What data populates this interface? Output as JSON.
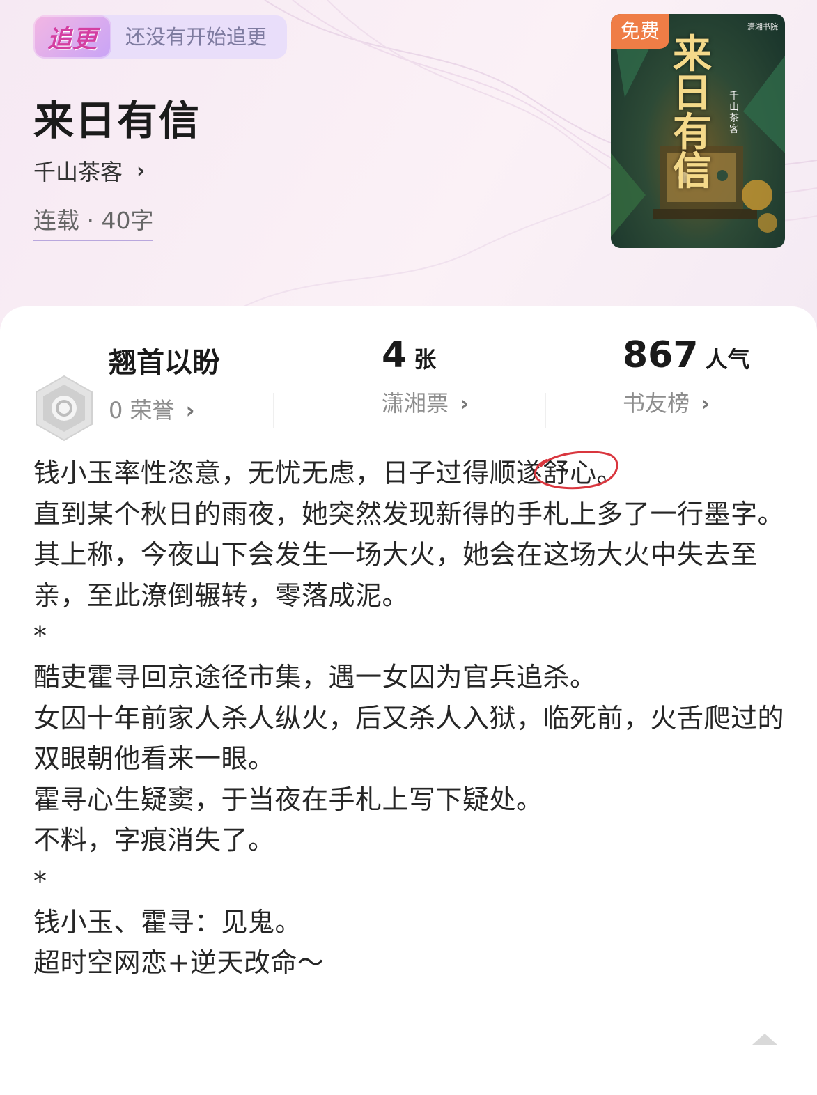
{
  "header": {
    "follow_button": "追更",
    "follow_status": "还没有开始追更",
    "title": "来日有信",
    "author": "千山茶客",
    "author_chevron": "›",
    "status": "连载 · 40字"
  },
  "cover": {
    "badge": "免费",
    "publisher": "潇湘书院",
    "title": "来日有信",
    "author": "千山茶客"
  },
  "stats": {
    "honor": {
      "title": "翘首以盼",
      "sub": "0 荣誉",
      "arrow": "›",
      "icon": "medal-icon"
    },
    "tickets": {
      "value": "4",
      "unit": "张",
      "sub": "潇湘票",
      "arrow": "›"
    },
    "popularity": {
      "value": "867",
      "unit": "人气",
      "sub": "书友榜",
      "arrow": "›"
    }
  },
  "description": {
    "line1_before": "钱小玉率性恣意，无忧无虑，日子过得顺遂",
    "line1_highlight": "舒心",
    "line1_after": "。",
    "p2": "直到某个秋日的雨夜，她突然发现新得的手札上多了一行墨字。",
    "p3": "其上称，今夜山下会发生一场大火，她会在这场大火中失去至亲，至此潦倒辗转，零落成泥。",
    "sep1": "*",
    "p4": "酷吏霍寻回京途径市集，遇一女囚为官兵追杀。",
    "p5": "女囚十年前家人杀人纵火，后又杀人入狱，临死前，火舌爬过的双眼朝他看来一眼。",
    "p6": "霍寻心生疑窦，于当夜在手札上写下疑处。",
    "p7": "不料，字痕消失了。",
    "sep2": "*",
    "p8": "钱小玉、霍寻：见鬼。",
    "p9": "超时空网恋+逆天改命～"
  },
  "colors": {
    "accent": "#d43fa1",
    "badge": "#ef7d46",
    "circle_annotation": "#d9363e"
  }
}
